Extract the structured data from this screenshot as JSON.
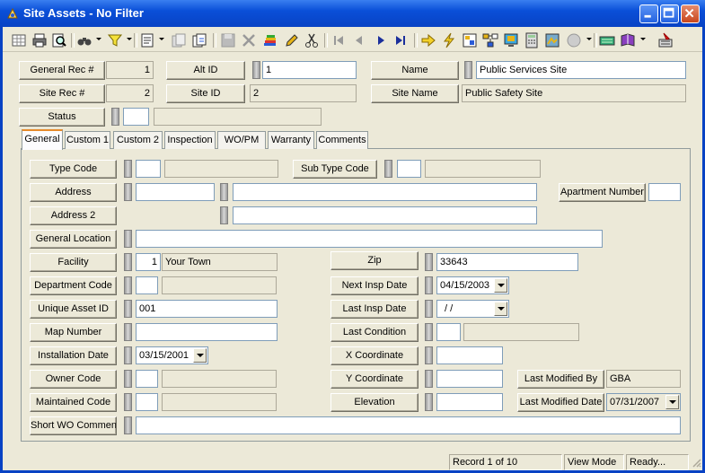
{
  "window": {
    "title": "Site Assets - No Filter"
  },
  "header": {
    "general_rec_label": "General Rec #",
    "general_rec_value": "1",
    "alt_id_label": "Alt ID",
    "alt_id_value": "1",
    "name_label": "Name",
    "name_value": "Public Services Site",
    "site_rec_label": "Site Rec #",
    "site_rec_value": "2",
    "site_id_label": "Site ID",
    "site_id_value": "2",
    "site_name_label": "Site Name",
    "site_name_value": "Public Safety Site",
    "status_label": "Status",
    "status_code": "",
    "status_desc": ""
  },
  "tabs": [
    "General",
    "Custom 1",
    "Custom 2",
    "Inspection",
    "WO/PM",
    "Warranty",
    "Comments"
  ],
  "form": {
    "type_code_label": "Type Code",
    "type_code": "",
    "type_code_desc": "",
    "sub_type_code_label": "Sub Type Code",
    "sub_type_code": "",
    "sub_type_code_desc": "",
    "address_label": "Address",
    "address_num": "",
    "address_street": "",
    "apartment_number_label": "Apartment Number",
    "apartment_number": "",
    "address2_label": "Address 2",
    "address2": "",
    "general_location_label": "General Location",
    "general_location": "",
    "facility_label": "Facility",
    "facility_code": "1",
    "facility_name": "Your Town",
    "zip_label": "Zip",
    "zip": "33643",
    "department_code_label": "Department Code",
    "department_code": "",
    "department_desc": "",
    "next_insp_date_label": "Next Insp Date",
    "next_insp_date": "04/15/2003",
    "unique_asset_id_label": "Unique Asset ID",
    "unique_asset_id": "001",
    "last_insp_date_label": "Last Insp Date",
    "last_insp_date": " /  /",
    "map_number_label": "Map Number",
    "map_number": "",
    "last_condition_label": "Last Condition",
    "last_condition": "",
    "last_condition_desc": "",
    "installation_date_label": "Installation Date",
    "installation_date": "03/15/2001",
    "x_coordinate_label": "X Coordinate",
    "x_coordinate": "",
    "owner_code_label": "Owner Code",
    "owner_code": "",
    "owner_desc": "",
    "y_coordinate_label": "Y Coordinate",
    "y_coordinate": "",
    "last_modified_by_label": "Last Modified By",
    "last_modified_by": "GBA",
    "maintained_code_label": "Maintained Code",
    "maintained_code": "",
    "maintained_desc": "",
    "elevation_label": "Elevation",
    "elevation": "",
    "last_modified_date_label": "Last Modified Date",
    "last_modified_date": "07/31/2007",
    "short_wo_comment_label": "Short WO Comment",
    "short_wo_comment": ""
  },
  "statusbar": {
    "record": "Record 1 of 10",
    "mode": "View Mode",
    "state": "Ready..."
  }
}
